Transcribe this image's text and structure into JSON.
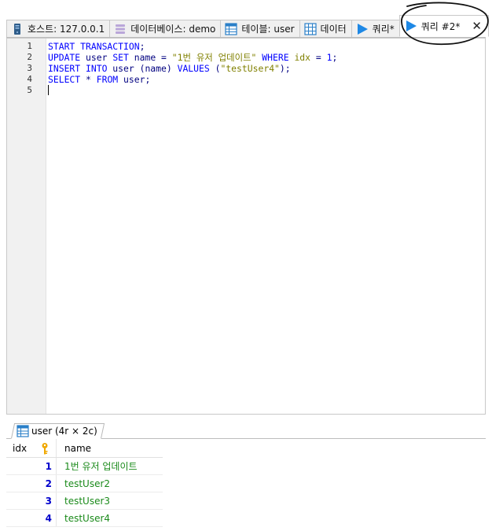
{
  "tabs": [
    {
      "label": "호스트: 127.0.0.1",
      "icon": "server-icon"
    },
    {
      "label": "데이터베이스: demo",
      "icon": "database-icon"
    },
    {
      "label": "테이블: user",
      "icon": "table-icon"
    },
    {
      "label": "데이터",
      "icon": "grid-icon"
    },
    {
      "label": "쿼리*",
      "icon": "play-icon"
    },
    {
      "label": "쿼리 #2*",
      "icon": "play-icon",
      "active": true,
      "close": "✕"
    }
  ],
  "editor": {
    "line_numbers": [
      "1",
      "2",
      "3",
      "4",
      "5"
    ],
    "lines": [
      [
        [
          "kw",
          "START TRANSACTION"
        ],
        [
          "plain",
          ";"
        ]
      ],
      [
        [
          "kw",
          "UPDATE"
        ],
        [
          "plain",
          " user "
        ],
        [
          "kw",
          "SET"
        ],
        [
          "plain",
          " name = "
        ],
        [
          "str",
          "\"1번 유저 업데이트\""
        ],
        [
          "plain",
          " "
        ],
        [
          "kw",
          "WHERE"
        ],
        [
          "plain",
          " "
        ],
        [
          "fld",
          "idx"
        ],
        [
          "plain",
          " = "
        ],
        [
          "num",
          "1"
        ],
        [
          "plain",
          ";"
        ]
      ],
      [
        [
          "kw",
          "INSERT INTO"
        ],
        [
          "plain",
          " user (name) "
        ],
        [
          "kw",
          "VALUES"
        ],
        [
          "plain",
          " ("
        ],
        [
          "str",
          "\"testUser4\""
        ],
        [
          "plain",
          ");"
        ]
      ],
      [
        [
          "kw",
          "SELECT"
        ],
        [
          "plain",
          " * "
        ],
        [
          "kw",
          "FROM"
        ],
        [
          "plain",
          " user;"
        ]
      ],
      []
    ]
  },
  "result": {
    "tab_label": "user (4r × 2c)",
    "columns": [
      "idx",
      "name"
    ],
    "rows": [
      {
        "idx": "1",
        "name": "1번 유저 업데이트"
      },
      {
        "idx": "2",
        "name": "testUser2"
      },
      {
        "idx": "3",
        "name": "testUser3"
      },
      {
        "idx": "4",
        "name": "testUser4"
      }
    ]
  },
  "colors": {
    "keyword": "#0000ff",
    "string": "#808000",
    "cell_value": "#1a8a1a",
    "row_number": "#0000cc"
  }
}
